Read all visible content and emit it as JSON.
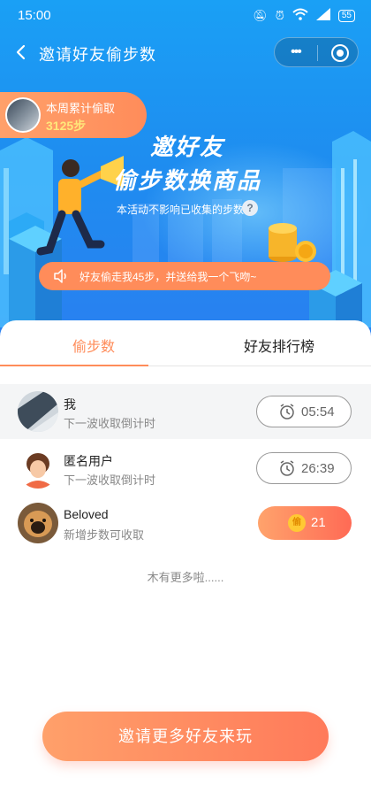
{
  "status_bar": {
    "time": "15:00",
    "battery": "55"
  },
  "nav": {
    "title": "邀请好友偷步数"
  },
  "weekly": {
    "label": "本周累计偷取",
    "value": "3125步"
  },
  "hero": {
    "title_line1": "邀好友",
    "title_line2": "偷步数换商品",
    "subtitle": "本活动不影响已收集的步数",
    "help": "?"
  },
  "notice": {
    "text": "好友偷走我45步，并送给我一个飞吻~"
  },
  "tabs": [
    {
      "label": "偷步数"
    },
    {
      "label": "好友排行榜"
    }
  ],
  "friends": [
    {
      "name": "我",
      "status": "下一波收取倒计时",
      "action": "05:54"
    },
    {
      "name": "匿名用户",
      "status": "下一波收取倒计时",
      "action": "26:39"
    },
    {
      "name": "Beloved",
      "status": "新增步数可收取",
      "action": "21",
      "coin_glyph": "偷"
    }
  ],
  "no_more": "木有更多啦......",
  "invite_button": "邀请更多好友来玩",
  "colors": {
    "accent": "#ff8c5a",
    "hero_blue": "#1e8df0"
  }
}
